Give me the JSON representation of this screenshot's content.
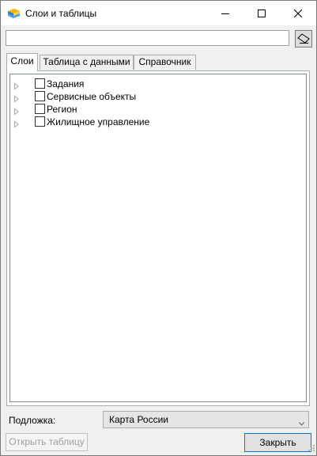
{
  "window": {
    "title": "Слои и таблицы",
    "icon": "layers-app-icon"
  },
  "search": {
    "value": "",
    "placeholder": "",
    "clear_icon": "eraser-icon"
  },
  "tabs": [
    {
      "label": "Слои",
      "active": true
    },
    {
      "label": "Таблица с данными",
      "active": false
    },
    {
      "label": "Справочник",
      "active": false
    }
  ],
  "layers": [
    {
      "label": "Задания",
      "checked": false,
      "expandable": true
    },
    {
      "label": "Сервисные объекты",
      "checked": false,
      "expandable": true
    },
    {
      "label": "Регион",
      "checked": false,
      "expandable": true
    },
    {
      "label": "Жилищное управление",
      "checked": false,
      "expandable": true
    }
  ],
  "basemap": {
    "label": "Подложка:",
    "selected": "Карта России"
  },
  "buttons": {
    "open_table": "Открыть таблицу",
    "close": "Закрыть"
  },
  "colors": {
    "accent_border": "#0078d7",
    "disabled_text": "#a0a0a0"
  }
}
